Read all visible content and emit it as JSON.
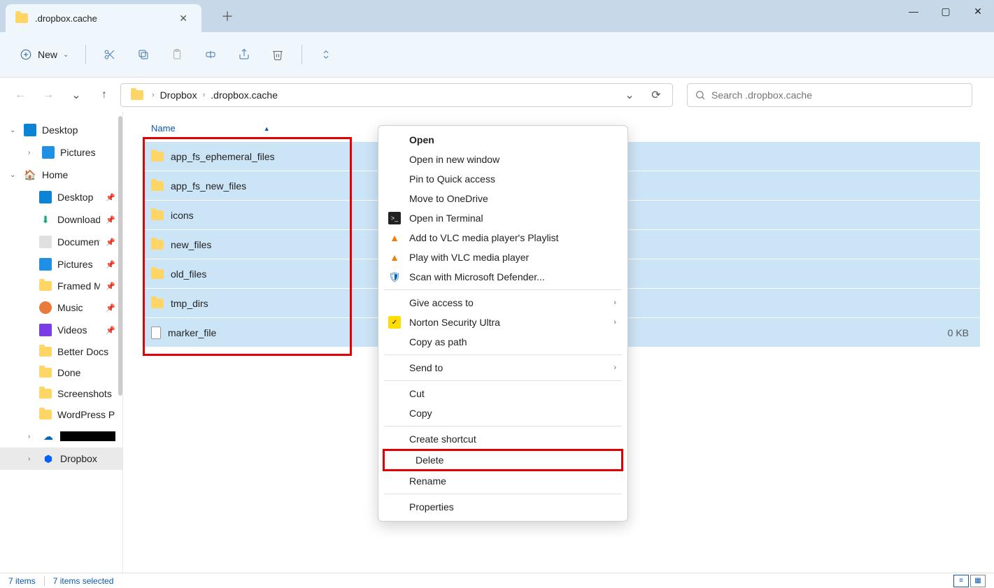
{
  "window": {
    "tab_title": ".dropbox.cache"
  },
  "toolbar": {
    "new_label": "New"
  },
  "breadcrumb": {
    "items": [
      "Dropbox",
      ".dropbox.cache"
    ]
  },
  "search": {
    "placeholder": "Search .dropbox.cache"
  },
  "sidebar": {
    "desktop": "Desktop",
    "pictures": "Pictures",
    "home": "Home",
    "items": [
      {
        "label": "Desktop"
      },
      {
        "label": "Downloads"
      },
      {
        "label": "Documents"
      },
      {
        "label": "Pictures"
      },
      {
        "label": "Framed M"
      },
      {
        "label": "Music"
      },
      {
        "label": "Videos"
      },
      {
        "label": "Better Docs"
      },
      {
        "label": "Done"
      },
      {
        "label": "Screenshots"
      },
      {
        "label": "WordPress Pi"
      }
    ],
    "onedrive": "",
    "dropbox": "Dropbox"
  },
  "columns": {
    "name": "Name"
  },
  "files": [
    {
      "name": "app_fs_ephemeral_files",
      "type": "folder",
      "size": ""
    },
    {
      "name": "app_fs_new_files",
      "type": "folder",
      "size": ""
    },
    {
      "name": "icons",
      "type": "folder",
      "size": ""
    },
    {
      "name": "new_files",
      "type": "folder",
      "size": ""
    },
    {
      "name": "old_files",
      "type": "folder",
      "size": ""
    },
    {
      "name": "tmp_dirs",
      "type": "folder",
      "size": ""
    },
    {
      "name": "marker_file",
      "type": "file",
      "size": "0 KB"
    }
  ],
  "context_menu": {
    "open": "Open",
    "open_new_window": "Open in new window",
    "pin_quick_access": "Pin to Quick access",
    "move_onedrive": "Move to OneDrive",
    "open_terminal": "Open in Terminal",
    "add_vlc_playlist": "Add to VLC media player's Playlist",
    "play_vlc": "Play with VLC media player",
    "scan_defender": "Scan with Microsoft Defender...",
    "give_access": "Give access to",
    "norton": "Norton Security Ultra",
    "copy_as_path": "Copy as path",
    "send_to": "Send to",
    "cut": "Cut",
    "copy": "Copy",
    "create_shortcut": "Create shortcut",
    "delete": "Delete",
    "rename": "Rename",
    "properties": "Properties"
  },
  "status": {
    "items": "7 items",
    "selected": "7 items selected"
  }
}
